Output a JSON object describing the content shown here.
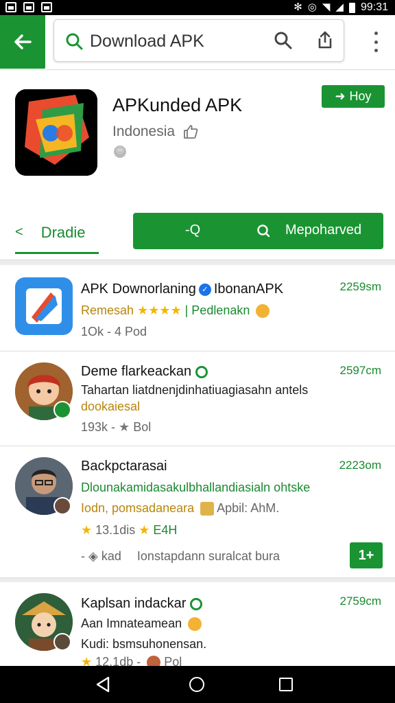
{
  "status_bar": {
    "time": "99:31"
  },
  "search": {
    "query": "Download APK"
  },
  "app": {
    "title": "APKunded APK",
    "subtitle": "Indonesia",
    "badge": "ⓜ",
    "play_label": "Hoy"
  },
  "tabs": {
    "active_label": "Dradie",
    "search_label": "-Q",
    "right_label": "Mepoharved"
  },
  "list": [
    {
      "title_prefix": "APK Downorlaning",
      "title_suffix": "IbonanAPK",
      "time": "2259sm",
      "line1_left": "Remesah",
      "line1_stars": "★★★★",
      "line1_right": "| Pedlenakn",
      "line2": "1Ok - 4 Pod"
    },
    {
      "title": "Deme flarkeackan",
      "time": "2597cm",
      "line1": "Tahartan liatdnenjdinhatiuagiasahn antels",
      "line2": "dookaiesal",
      "line3_a": "193k -",
      "line3_b": "Bol"
    },
    {
      "title": "Backpctarasai",
      "time": "2223om",
      "line1": "Dlounakamidasakulbhallandiasialn ohtske",
      "line2_left": "Iodn, pomsadaneara",
      "line2_right": "Apbil:  AhM.",
      "line3_a": "13.1dis",
      "line3_b": "E4H",
      "line4_left": "kad",
      "line4_right": "Ionstapdann suralcat bura",
      "action_label": "1+"
    },
    {
      "title": "Kaplsan indackar",
      "time": "2759cm",
      "line1": "Aan Imnateamean",
      "line2": "Kudi: bsmsuhonensan.",
      "line3_a": "12.1db -",
      "line3_b": "Pol"
    }
  ],
  "colors": {
    "accent": "#1a9432",
    "link_green": "#1a8a30",
    "divider": "#ececec"
  }
}
